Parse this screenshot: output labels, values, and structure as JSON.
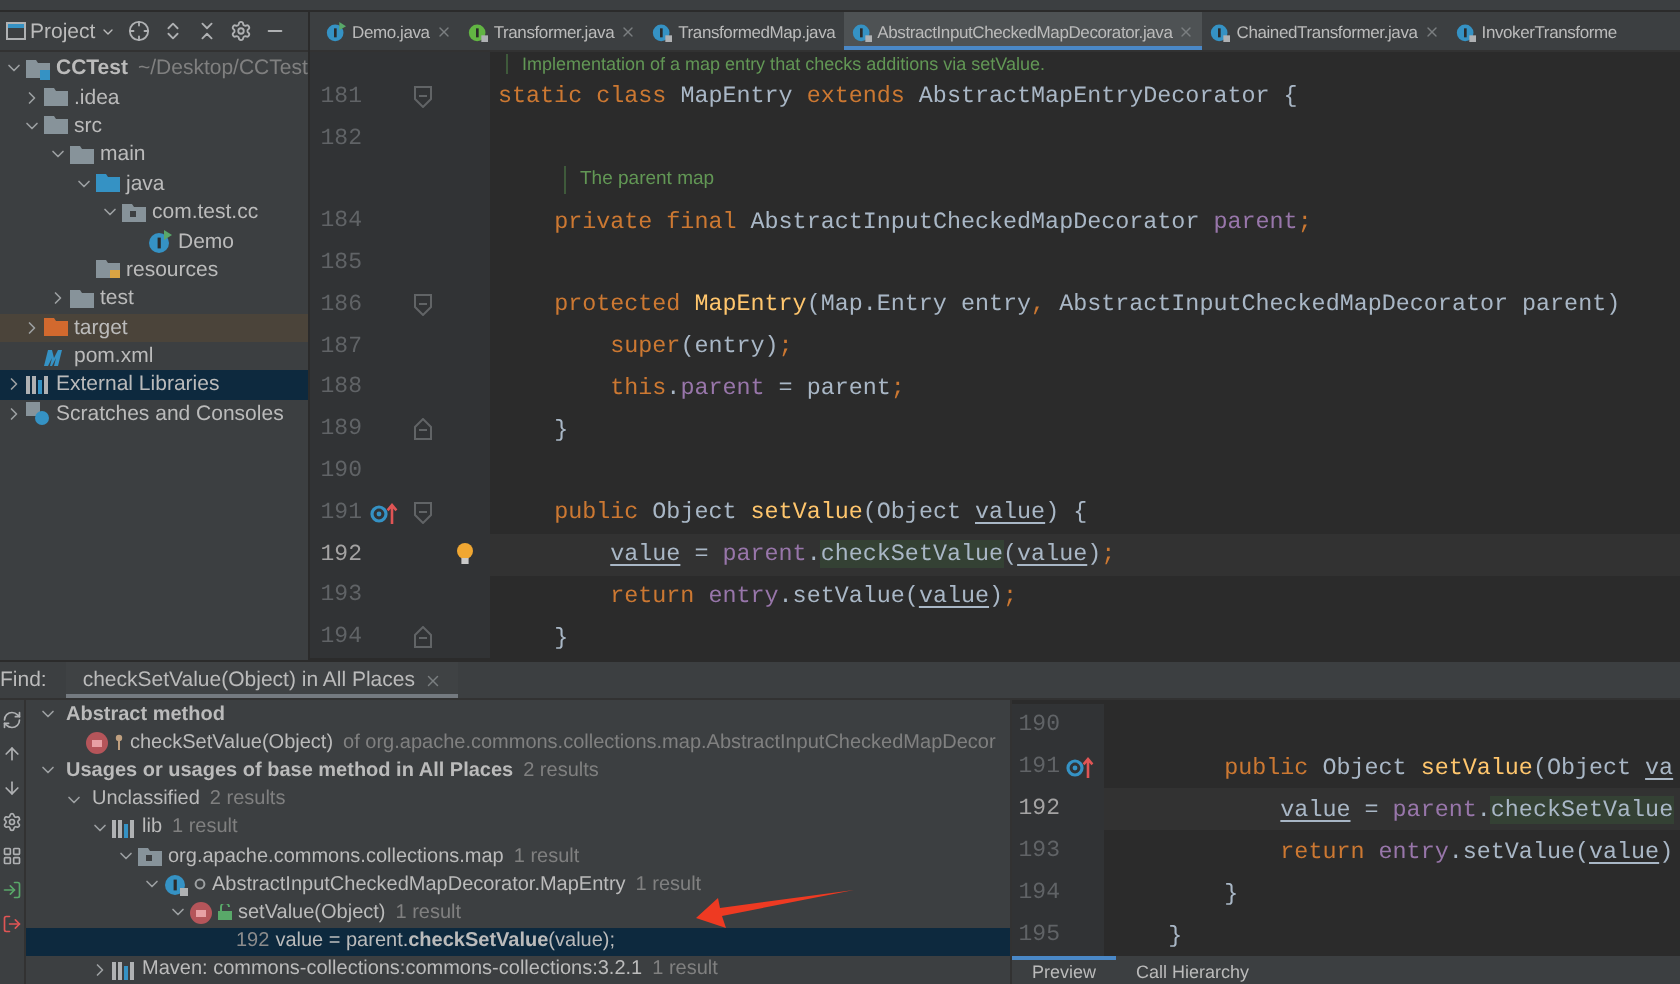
{
  "project_panel": {
    "title": "Project",
    "tree": [
      {
        "label": "CCTest",
        "detail": "~/Desktop/CCTest",
        "kind": "module",
        "bold": true,
        "expanded": true,
        "selected": false,
        "children": [
          {
            "label": ".idea",
            "kind": "folder",
            "expanded": false,
            "selected": false
          },
          {
            "label": "src",
            "kind": "folder",
            "expanded": true,
            "selected": false,
            "children": [
              {
                "label": "main",
                "kind": "folder",
                "expanded": true,
                "selected": false,
                "children": [
                  {
                    "label": "java",
                    "kind": "source-folder",
                    "expanded": true,
                    "selected": false,
                    "children": [
                      {
                        "label": "com.test.cc",
                        "kind": "package",
                        "expanded": true,
                        "selected": false,
                        "children": [
                          {
                            "label": "Demo",
                            "kind": "class-run",
                            "selected": false
                          }
                        ]
                      }
                    ]
                  },
                  {
                    "label": "resources",
                    "kind": "resources-folder",
                    "selected": false
                  }
                ]
              },
              {
                "label": "test",
                "kind": "folder",
                "expanded": false,
                "selected": false
              }
            ]
          },
          {
            "label": "target",
            "kind": "excluded-folder",
            "expanded": false,
            "selected": false
          },
          {
            "label": "pom.xml",
            "kind": "maven",
            "selected": false
          }
        ]
      },
      {
        "label": "External Libraries",
        "kind": "library",
        "expanded": false,
        "selected": true
      },
      {
        "label": "Scratches and Consoles",
        "kind": "scratches",
        "expanded": false,
        "selected": false
      }
    ]
  },
  "editor_tabs": [
    {
      "label": "Demo.java",
      "kind": "class-run",
      "closable": true,
      "selected": false
    },
    {
      "label": "Transformer.java",
      "kind": "interface-locked",
      "closable": true,
      "selected": false
    },
    {
      "label": "TransformedMap.java",
      "kind": "class-locked",
      "closable": false,
      "selected": false
    },
    {
      "label": "AbstractInputCheckedMapDecorator.java",
      "kind": "class-locked",
      "closable": true,
      "selected": true
    },
    {
      "label": "ChainedTransformer.java",
      "kind": "class-locked",
      "closable": true,
      "selected": false
    },
    {
      "label": "InvokerTransforme",
      "kind": "class-locked",
      "closable": false,
      "selected": false
    }
  ],
  "editor": {
    "lines": [
      {
        "kind": "doc-class",
        "text": "Implementation of a map entry that checks additions via setValue."
      },
      {
        "kind": "code",
        "number": "181",
        "gutter": [
          {
            "kind": "fold-start"
          }
        ],
        "current": false,
        "tokens": [
          {
            "text": "static class ",
            "kind": "kw"
          },
          {
            "text": "MapEntry ",
            "kind": "plain"
          },
          {
            "text": "extends ",
            "kind": "kw"
          },
          {
            "text": "AbstractMapEntryDecorator {",
            "kind": "plain"
          }
        ]
      },
      {
        "kind": "code",
        "number": "182",
        "current": false
      },
      {
        "kind": "doc-member",
        "text": "The parent map"
      },
      {
        "kind": "code",
        "number": "184",
        "current": false,
        "tokens": [
          {
            "text": "    private final ",
            "kind": "kw"
          },
          {
            "text": "AbstractInputCheckedMapDecorator ",
            "kind": "plain"
          },
          {
            "text": "parent",
            "kind": "field"
          },
          {
            "text": ";",
            "kind": "kw"
          }
        ]
      },
      {
        "kind": "code",
        "number": "185",
        "current": false
      },
      {
        "kind": "code",
        "number": "186",
        "gutter": [
          {
            "kind": "fold-start"
          }
        ],
        "current": false,
        "tokens": [
          {
            "text": "    protected ",
            "kind": "kw"
          },
          {
            "text": "MapEntry",
            "kind": "method"
          },
          {
            "text": "(Map.Entry entry",
            "kind": "plain"
          },
          {
            "text": ", ",
            "kind": "kw"
          },
          {
            "text": "AbstractInputCheckedMapDecorator parent)",
            "kind": "plain"
          }
        ]
      },
      {
        "kind": "code",
        "number": "187",
        "current": false,
        "tokens": [
          {
            "text": "        super",
            "kind": "kw"
          },
          {
            "text": "(entry)",
            "kind": "plain"
          },
          {
            "text": ";",
            "kind": "kw"
          }
        ]
      },
      {
        "kind": "code",
        "number": "188",
        "current": false,
        "tokens": [
          {
            "text": "        this",
            "kind": "kw"
          },
          {
            "text": ".",
            "kind": "plain"
          },
          {
            "text": "parent",
            "kind": "field"
          },
          {
            "text": " = parent",
            "kind": "plain"
          },
          {
            "text": ";",
            "kind": "kw"
          }
        ]
      },
      {
        "kind": "code",
        "number": "189",
        "gutter": [
          {
            "kind": "fold-end"
          }
        ],
        "current": false,
        "tokens": [
          {
            "text": "    }",
            "kind": "plain"
          }
        ]
      },
      {
        "kind": "code",
        "number": "190",
        "current": false
      },
      {
        "kind": "code",
        "number": "191",
        "gutter": [
          {
            "kind": "override"
          },
          {
            "kind": "fold-start"
          }
        ],
        "current": false,
        "tokens": [
          {
            "text": "    public ",
            "kind": "kw"
          },
          {
            "text": "Object ",
            "kind": "plain"
          },
          {
            "text": "setValue",
            "kind": "method"
          },
          {
            "text": "(Object ",
            "kind": "plain"
          },
          {
            "text": "value",
            "kind": "param"
          },
          {
            "text": ") {",
            "kind": "plain"
          }
        ]
      },
      {
        "kind": "code",
        "number": "192",
        "gutter": [
          {
            "kind": "bulb"
          }
        ],
        "current": true,
        "tokens": [
          {
            "text": "        value",
            "kind": "param"
          },
          {
            "text": " = ",
            "kind": "plain"
          },
          {
            "text": "parent",
            "kind": "field"
          },
          {
            "text": ".",
            "kind": "plain"
          },
          {
            "text": "checkSetValue",
            "kind": "match"
          },
          {
            "text": "(",
            "kind": "plain"
          },
          {
            "text": "value",
            "kind": "param"
          },
          {
            "text": ")",
            "kind": "plain"
          },
          {
            "text": ";",
            "kind": "kw"
          }
        ]
      },
      {
        "kind": "code",
        "number": "193",
        "current": false,
        "tokens": [
          {
            "text": "        return ",
            "kind": "kw"
          },
          {
            "text": "entry",
            "kind": "field"
          },
          {
            "text": ".setValue(",
            "kind": "plain"
          },
          {
            "text": "value",
            "kind": "param"
          },
          {
            "text": ")",
            "kind": "plain"
          },
          {
            "text": ";",
            "kind": "kw"
          }
        ]
      },
      {
        "kind": "code",
        "number": "194",
        "gutter": [
          {
            "kind": "fold-end"
          }
        ],
        "current": false,
        "tokens": [
          {
            "text": "    }",
            "kind": "plain"
          }
        ]
      }
    ]
  },
  "find_panel": {
    "label": "Find:",
    "tab": {
      "label": "checkSetValue(Object) in All Places",
      "selected": true
    },
    "tree": [
      {
        "label": "Abstract method",
        "bold": true,
        "expanded": true,
        "selected": false,
        "children": [
          {
            "label": "checkSetValue(Object)",
            "kind": "method-protected",
            "detail": "of org.apache.commons.collections.map.AbstractInputCheckedMapDecor",
            "selected": false
          }
        ]
      },
      {
        "label": "Usages or usages of base method in All Places",
        "bold": true,
        "detail": "2 results",
        "expanded": true,
        "selected": false,
        "children": [
          {
            "label": "Unclassified",
            "detail": "2 results",
            "expanded": true,
            "selected": false,
            "children": [
              {
                "label": "lib",
                "kind": "library",
                "detail": "1 result",
                "expanded": true,
                "selected": false,
                "children": [
                  {
                    "label": "org.apache.commons.collections.map",
                    "kind": "package",
                    "detail": "1 result",
                    "expanded": true,
                    "selected": false,
                    "children": [
                      {
                        "label": "AbstractInputCheckedMapDecorator.MapEntry",
                        "kind": "class-package",
                        "detail": "1 result",
                        "expanded": true,
                        "selected": false,
                        "children": [
                          {
                            "label": "setValue(Object)",
                            "kind": "method-public",
                            "detail": "1 result",
                            "expanded": true,
                            "selected": false,
                            "children": [
                              {
                                "number": "192",
                                "label": "value = parent.**checkSetValue**(value);",
                                "selected": true
                              }
                            ]
                          }
                        ]
                      }
                    ]
                  }
                ]
              },
              {
                "label": "Maven: commons-collections:commons-collections:3.2.1",
                "kind": "library",
                "detail": "1 result",
                "expanded": false,
                "selected": false
              }
            ]
          }
        ]
      }
    ]
  },
  "preview": {
    "lines": [
      {
        "number": "190",
        "current": false
      },
      {
        "number": "191",
        "gutter": [
          {
            "kind": "override"
          }
        ],
        "current": false,
        "tokens": [
          {
            "text": "        public ",
            "kind": "kw"
          },
          {
            "text": "Object ",
            "kind": "plain"
          },
          {
            "text": "setValue",
            "kind": "method"
          },
          {
            "text": "(Object ",
            "kind": "plain"
          },
          {
            "text": "va",
            "kind": "param"
          }
        ]
      },
      {
        "number": "192",
        "current": true,
        "tokens": [
          {
            "text": "            value",
            "kind": "param"
          },
          {
            "text": " = ",
            "kind": "plain"
          },
          {
            "text": "parent",
            "kind": "field"
          },
          {
            "text": ".",
            "kind": "plain"
          },
          {
            "text": "checkSetValue",
            "kind": "match"
          }
        ]
      },
      {
        "number": "193",
        "current": false,
        "tokens": [
          {
            "text": "            return ",
            "kind": "kw"
          },
          {
            "text": "entry",
            "kind": "field"
          },
          {
            "text": ".setValue(",
            "kind": "plain"
          },
          {
            "text": "value",
            "kind": "param"
          },
          {
            "text": ")",
            "kind": "plain"
          }
        ]
      },
      {
        "number": "194",
        "current": false,
        "tokens": [
          {
            "text": "        }",
            "kind": "plain"
          }
        ]
      },
      {
        "number": "195",
        "current": false,
        "tokens": [
          {
            "text": "    }",
            "kind": "plain"
          }
        ]
      }
    ]
  },
  "bottom_tabs": [
    {
      "label": "Preview",
      "selected": true
    },
    {
      "label": "Call Hierarchy",
      "selected": false
    }
  ]
}
